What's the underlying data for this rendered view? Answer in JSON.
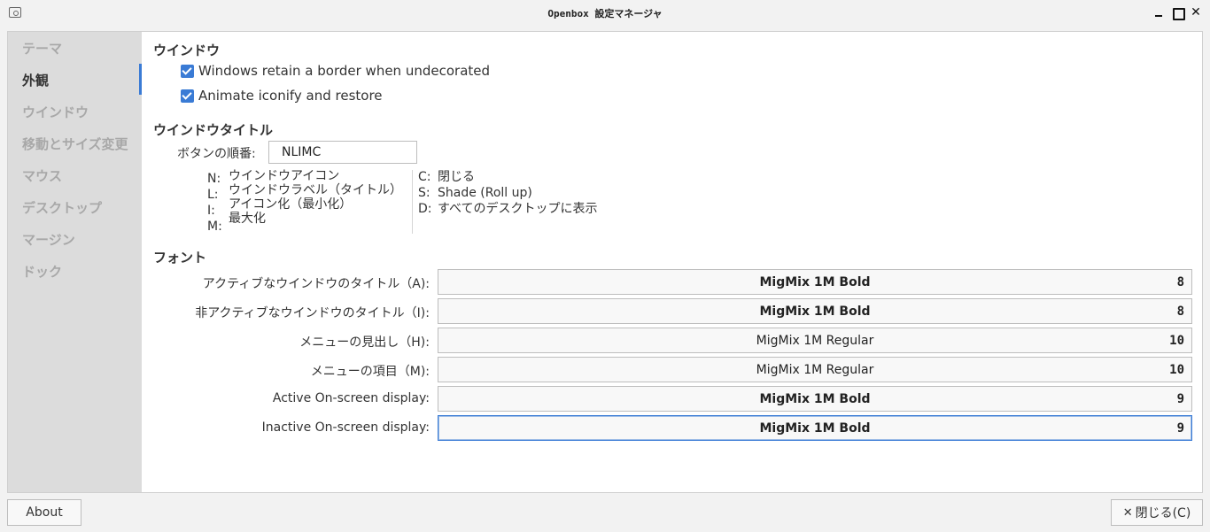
{
  "window": {
    "title": "Openbox 設定マネージャ"
  },
  "sidebar": {
    "items": [
      {
        "label": "テーマ",
        "active": false
      },
      {
        "label": "外観",
        "active": true
      },
      {
        "label": "ウインドウ",
        "active": false
      },
      {
        "label": "移動とサイズ変更",
        "active": false
      },
      {
        "label": "マウス",
        "active": false
      },
      {
        "label": "デスクトップ",
        "active": false
      },
      {
        "label": "マージン",
        "active": false
      },
      {
        "label": "ドック",
        "active": false
      }
    ]
  },
  "windows_section": {
    "title": "ウインドウ",
    "retain_border": {
      "label": "Windows retain a border when undecorated",
      "checked": true
    },
    "animate_iconify": {
      "label": "Animate iconify and restore",
      "checked": true
    }
  },
  "titlebar_section": {
    "title": "ウインドウタイトル",
    "button_order_label": "ボタンの順番:",
    "button_order_value": "NLIMC",
    "legend_left_keys": [
      "N:",
      "L:",
      "I:",
      "M:"
    ],
    "legend_left_values": [
      "ウインドウアイコン",
      "ウインドウラベル（タイトル）",
      "アイコン化（最小化）",
      "最大化"
    ],
    "legend_right_keys": [
      "C:",
      "S:",
      "D:"
    ],
    "legend_right_values": [
      "閉じる",
      "Shade (Roll up)",
      "すべてのデスクトップに表示"
    ]
  },
  "fonts_section": {
    "title": "フォント",
    "rows": [
      {
        "label": "アクティブなウインドウのタイトル（A):",
        "font": "MigMix 1M Bold",
        "size": "8",
        "bold": true
      },
      {
        "label": "非アクティブなウインドウのタイトル（I):",
        "font": "MigMix 1M Bold",
        "size": "8",
        "bold": true
      },
      {
        "label": "メニューの見出し（H):",
        "font": "MigMix 1M Regular",
        "size": "10",
        "bold": false
      },
      {
        "label": "メニューの項目（M):",
        "font": "MigMix 1M Regular",
        "size": "10",
        "bold": false
      },
      {
        "label": "Active On-screen display:",
        "font": "MigMix 1M Bold",
        "size": "9",
        "bold": true
      },
      {
        "label": "Inactive On-screen display:",
        "font": "MigMix 1M Bold",
        "size": "9",
        "bold": true
      }
    ]
  },
  "footer": {
    "about_label": "About",
    "close_label": "閉じる(C)"
  }
}
